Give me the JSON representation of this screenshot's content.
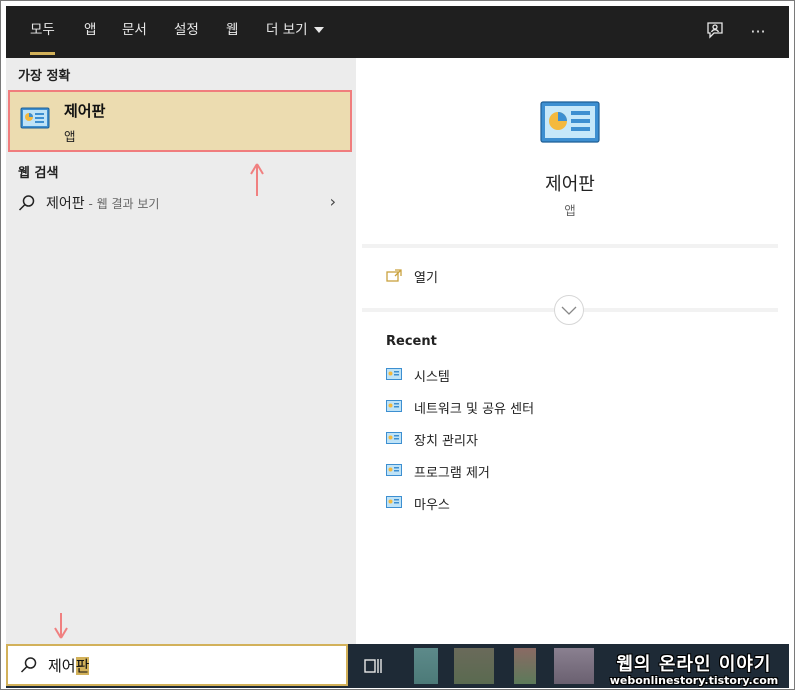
{
  "tabs": [
    {
      "label": "모두",
      "active": true
    },
    {
      "label": "앱"
    },
    {
      "label": "문서"
    },
    {
      "label": "설정"
    },
    {
      "label": "웹"
    },
    {
      "label": "더 보기"
    }
  ],
  "toolbar_icons": [
    "feedback-icon",
    "more-options-icon"
  ],
  "more_options_label": "···",
  "best_match": {
    "heading": "가장 정확",
    "title": "제어판",
    "subtitle": "앱",
    "icon": "control-panel-icon"
  },
  "web_search": {
    "heading": "웹 검색",
    "query": "제어판",
    "suffix": " - 웹 결과 보기",
    "chevron": "›"
  },
  "detail": {
    "app_name": "제어판",
    "app_type": "앱",
    "open_label": "열기",
    "recent_title": "Recent",
    "recent_items": [
      "시스템",
      "네트워크 및 공유 센터",
      "장치 관리자",
      "프로그램 제거",
      "마우스"
    ]
  },
  "search_box": {
    "typed": "제어",
    "suggested": "판"
  },
  "watermark": {
    "line1": "웹의 온라인 이야기",
    "line2": "webonlinestory.tistory.com"
  },
  "colors": {
    "accent": "#d2b15a",
    "highlight_border": "#f07d7d",
    "best_match_bg": "#ecdcb0",
    "topbar_bg": "#1f1f1f",
    "taskbar_bg": "#1e2a36"
  }
}
